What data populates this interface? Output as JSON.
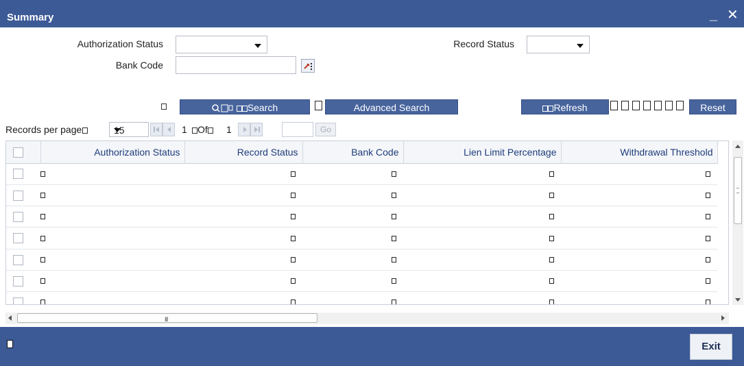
{
  "window": {
    "title": "Summary",
    "minimize_label": "_",
    "close_label": "✕"
  },
  "criteria": {
    "auth_status_label": "Authorization Status",
    "record_status_label": "Record Status",
    "bank_code_label": "Bank Code",
    "bank_code_value": ""
  },
  "toolbar": {
    "search_label": "Search",
    "advanced_search_label": "Advanced Search",
    "refresh_label": "Refresh",
    "reset_label": "Reset"
  },
  "pager": {
    "records_per_page_label": "Records per page",
    "records_per_page_value": "15",
    "current_page": "1",
    "of_label": "Of",
    "total_pages": "1",
    "go_label": "Go"
  },
  "grid": {
    "columns": [
      "Authorization Status",
      "Record Status",
      "Bank Code",
      "Lien Limit Percentage",
      "Withdrawal Threshold"
    ],
    "row_count": 7
  },
  "footer": {
    "exit_label": "Exit"
  },
  "colors": {
    "header_bar": "#3c5a96",
    "button_bg": "#47649d",
    "column_header_text": "#1e3c7a"
  }
}
